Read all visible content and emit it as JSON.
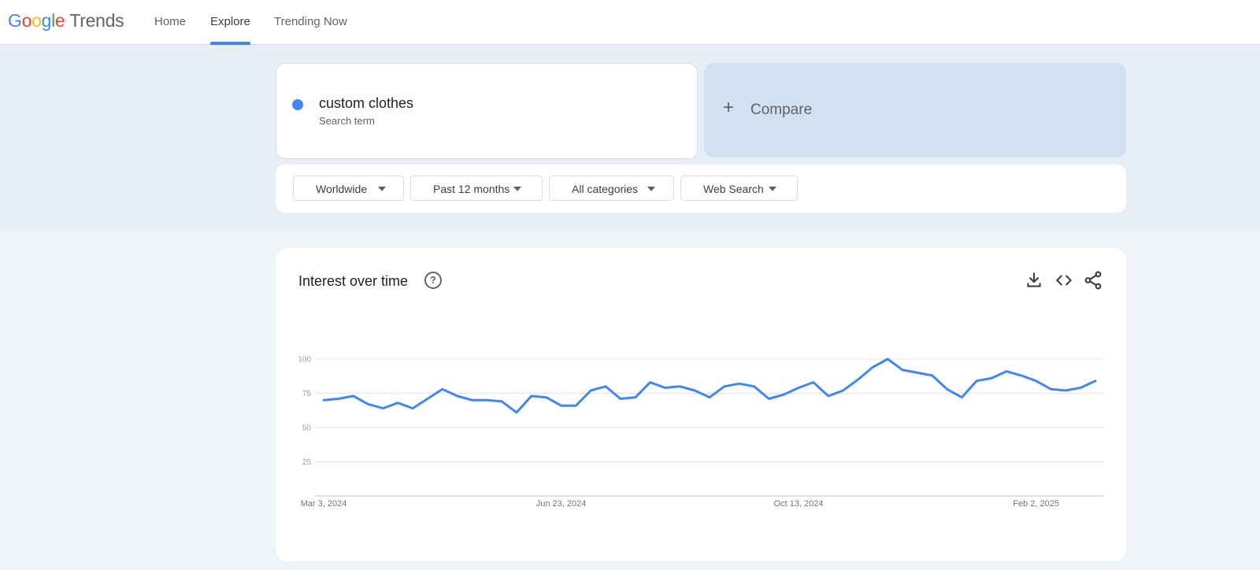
{
  "header": {
    "logo_letters": [
      "G",
      "o",
      "o",
      "g",
      "l",
      "e"
    ],
    "logo_suffix": "Trends",
    "nav": [
      {
        "label": "Home"
      },
      {
        "label": "Explore"
      },
      {
        "label": "Trending Now"
      }
    ],
    "active_tab": "Explore",
    "accent": "#4285f4"
  },
  "search": {
    "term": "custom clothes",
    "term_sub": "Search term",
    "term_color": "#4285f4",
    "compare_icon": "plus-icon",
    "compare_label": "Compare"
  },
  "filters": [
    {
      "label": "Worldwide"
    },
    {
      "label": "Past 12 months"
    },
    {
      "label": "All categories"
    },
    {
      "label": "Web Search"
    }
  ],
  "card": {
    "title": "Interest over time",
    "icons": [
      "help-icon",
      "download-icon",
      "embed-code-icon",
      "share-icon"
    ]
  },
  "chart_data": {
    "type": "line",
    "title": "Interest over time",
    "xlabel": "",
    "ylabel": "",
    "ylim": [
      0,
      100
    ],
    "yticks": [
      25,
      50,
      75,
      100
    ],
    "x_tick_labels": [
      "Mar 3, 2024",
      "Jun 23, 2024",
      "Oct 13, 2024",
      "Feb 2, 2025"
    ],
    "x_tick_indices": [
      0,
      16,
      32,
      48
    ],
    "grid": true,
    "legend": "none",
    "series": [
      {
        "name": "custom clothes",
        "color": "#4285f4",
        "values": [
          70,
          71,
          73,
          67,
          64,
          68,
          64,
          71,
          78,
          73,
          70,
          70,
          69,
          61,
          73,
          72,
          66,
          66,
          77,
          80,
          71,
          72,
          83,
          79,
          80,
          77,
          72,
          80,
          82,
          80,
          71,
          74,
          79,
          83,
          73,
          77,
          85,
          94,
          100,
          92,
          90,
          88,
          78,
          72,
          84,
          86,
          91,
          88,
          84,
          78,
          77,
          79,
          84
        ]
      }
    ]
  }
}
